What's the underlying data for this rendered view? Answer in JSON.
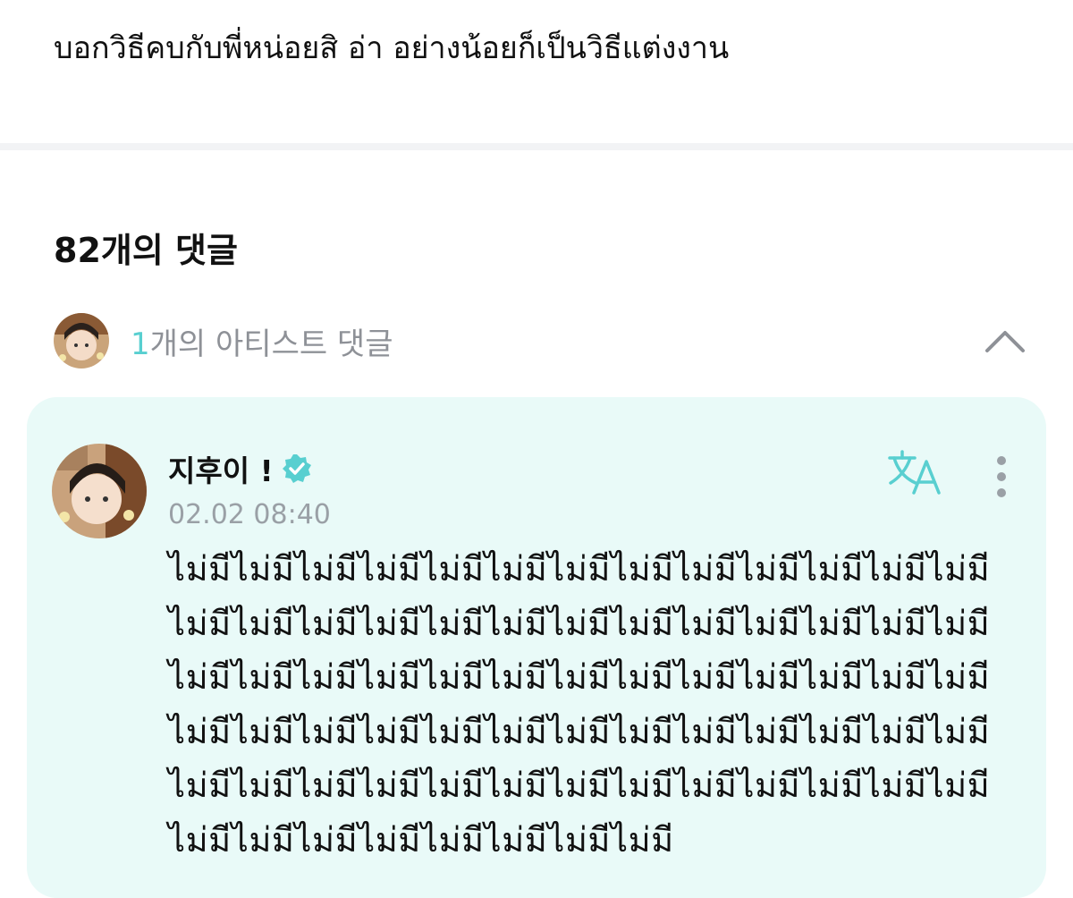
{
  "post": {
    "body_text": "บอกวิธีคบกับพี่หน่อยสิ อ่า อย่างน้อยก็เป็นวิธีแต่งงาน"
  },
  "comments": {
    "count_label": "82개의 댓글"
  },
  "artist_comments": {
    "count": "1",
    "summary_suffix": "개의 아티스트 댓글",
    "collapse_icon": "chevron-up-icon"
  },
  "comment": {
    "author": "지후이 !",
    "verified_icon": "verified-badge-icon",
    "timestamp": "02.02 08:40",
    "translate_icon": "translate-icon",
    "more_icon": "more-vertical-icon",
    "text": "ไม่มีไม่มีไม่มีไม่มีไม่มีไม่มีไม่มีไม่มีไม่มีไม่มีไม่มีไม่มีไม่มีไม่มีไม่มีไม่มีไม่มีไม่มีไม่มีไม่มีไม่มีไม่มีไม่มีไม่มีไม่มีไม่มีไม่มีไม่มีไม่มีไม่มีไม่มีไม่มีไม่มีไม่มีไม่มีไม่มีไม่มีไม่มีไม่มีไม่มีไม่มีไม่มีไม่มีไม่มีไม่มีไม่มีไม่มีไม่มีไม่มีไม่มีไม่มีไม่มีไม่มีไม่มีไม่มีไม่มีไม่มีไม่มีไม่มีไม่มีไม่มีไม่มีไม่มีไม่มีไม่มีไม่มีไม่มีไม่มีไม่มีไม่มีไม่มีไม่มีไม่มี"
  },
  "colors": {
    "accent": "#58cfd0",
    "card_background": "#e9faf8",
    "muted_text": "#8e9197",
    "divider": "#f2f3f5"
  }
}
